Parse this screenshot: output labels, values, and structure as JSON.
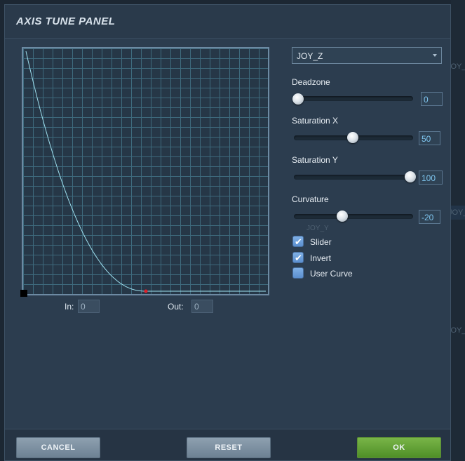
{
  "panel": {
    "title": "AXIS TUNE PANEL"
  },
  "axis_select": {
    "value": "JOY_Z"
  },
  "controls": {
    "deadzone": {
      "label": "Deadzone",
      "value": "0"
    },
    "saturation_x": {
      "label": "Saturation X",
      "value": "50"
    },
    "saturation_y": {
      "label": "Saturation Y",
      "value": "100"
    },
    "curvature": {
      "label": "Curvature",
      "value": "-20"
    }
  },
  "checkboxes": {
    "slider": {
      "label": "Slider",
      "checked": true
    },
    "invert": {
      "label": "Invert",
      "checked": true
    },
    "user_curve": {
      "label": "User Curve",
      "checked": false
    }
  },
  "io": {
    "in_label": "In:",
    "in_value": "0",
    "out_label": "Out:",
    "out_value": "0"
  },
  "buttons": {
    "cancel": "CANCEL",
    "reset": "RESET",
    "ok": "OK"
  },
  "background": {
    "label_1": "JOY_",
    "label_2": "JOY_",
    "label_3": "JOY_",
    "ghost_label": "JOY_Y"
  },
  "colors": {
    "curve": "#9fe0ef",
    "grid": "#3e6a7d",
    "marker": "#e0202a",
    "ok_button": "#5f9e33"
  }
}
